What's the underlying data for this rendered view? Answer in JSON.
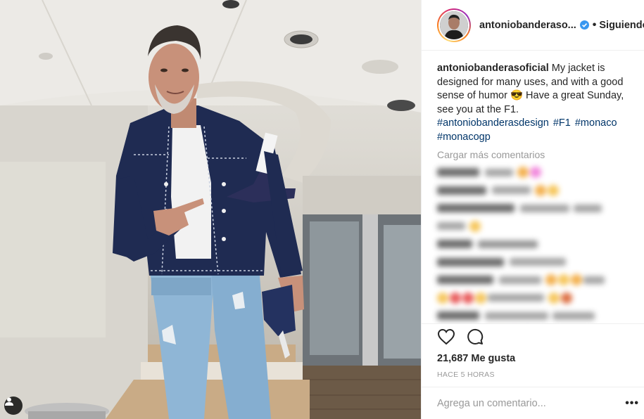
{
  "post": {
    "username": "antoniobanderasoficial",
    "header_username": "antoniobanderaso...",
    "separator": "•",
    "follow_label": "Siguiendo",
    "caption_text": "My jacket is designed for many uses, and with a good sense of humor 😎 Have a great Sunday, see you at the F1.",
    "hashtags": "#antoniobanderasdesign #F1 #monaco #monacogp",
    "load_more": "Cargar más comentarios",
    "likes": "21,687 Me gusta",
    "time": "HACE 5 HORAS",
    "comment_placeholder": "Agrega un comentario...",
    "more_options": "•••"
  },
  "icons": {
    "verified": "verified-badge-icon",
    "like": "heart-icon",
    "comment": "comment-bubble-icon",
    "tag": "user-tag-icon"
  },
  "colors": {
    "verified": "#3897f0",
    "hashtag": "#003569",
    "muted": "#999999"
  }
}
